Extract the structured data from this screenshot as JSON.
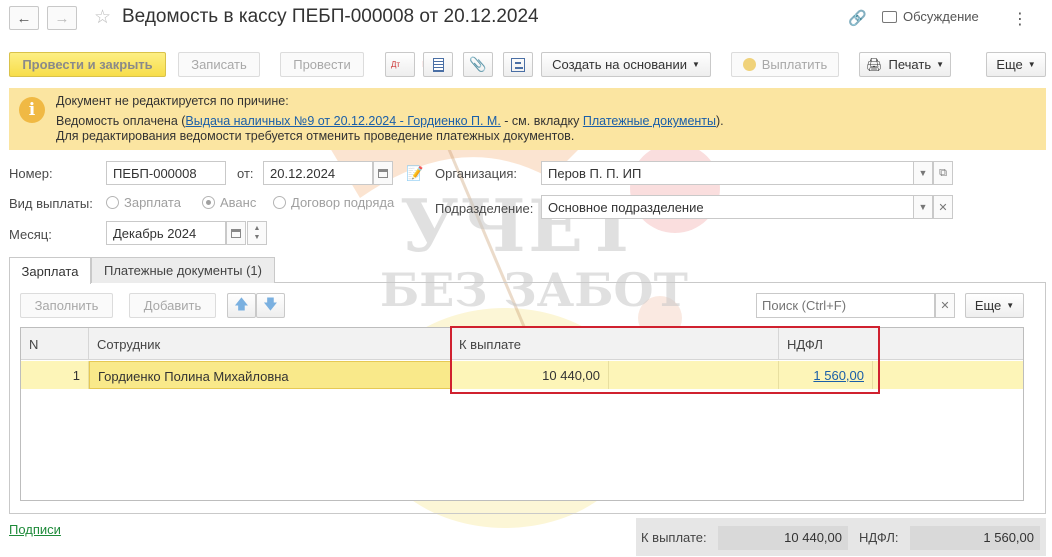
{
  "window": {
    "title": "Ведомость в кассу ПЕБП-000008 от 20.12.2024",
    "discussion": "Обсуждение"
  },
  "toolbar": {
    "post_close": "Провести и закрыть",
    "save": "Записать",
    "post": "Провести",
    "dt_kt": "Дт Кт",
    "create_based": "Создать на основании",
    "pay": "Выплатить",
    "print": "Печать",
    "more": "Еще"
  },
  "notice": {
    "line1": "Документ не редактируется по причине:",
    "line2_prefix": "Ведомость оплачена (",
    "line2_link": "Выдача наличных №9 от 20.12.2024 - Гордиенко П. М.",
    "line2_mid": " - см. вкладку ",
    "line2_link2": "Платежные документы",
    "line2_suffix": ").",
    "line3": "Для редактирования ведомости требуется отменить проведение платежных документов."
  },
  "form": {
    "number_label": "Номер:",
    "number_value": "ПЕБП-000008",
    "date_label": "от:",
    "date_value": "20.12.2024",
    "org_label": "Организация:",
    "org_value": "Перов П. П. ИП",
    "payment_type_label": "Вид выплаты:",
    "payment_types": [
      "Зарплата",
      "Аванс",
      "Договор подряда"
    ],
    "selected_payment_type": "Аванс",
    "dept_label": "Подразделение:",
    "dept_value": "Основное подразделение",
    "month_label": "Месяц:",
    "month_value": "Декабрь 2024"
  },
  "tabs": [
    {
      "label": "Зарплата",
      "active": true
    },
    {
      "label": "Платежные документы (1)",
      "active": false
    }
  ],
  "table_toolbar": {
    "fill": "Заполнить",
    "add": "Добавить",
    "search_placeholder": "Поиск (Ctrl+F)",
    "more": "Еще"
  },
  "table": {
    "columns": [
      "N",
      "Сотрудник",
      "К выплате",
      "НДФЛ"
    ],
    "rows": [
      {
        "n": "1",
        "employee": "Гордиенко Полина Михайловна",
        "to_pay": "10 440,00",
        "ndfl": "1 560,00"
      }
    ]
  },
  "footer": {
    "signatures": "Подписи",
    "to_pay_label": "К выплате:",
    "to_pay_value": "10 440,00",
    "ndfl_label": "НДФЛ:",
    "ndfl_value": "1 560,00"
  },
  "watermark": {
    "line1": "УЧЕТ",
    "line2": "БЕЗ ЗАБОТ"
  },
  "colors": {
    "primary_button": "#f7dd4a",
    "notice_bg": "#fbe5a1",
    "selected_row": "#fdf5b8",
    "highlight_box": "#d0212f",
    "link": "#1b5fa8"
  }
}
